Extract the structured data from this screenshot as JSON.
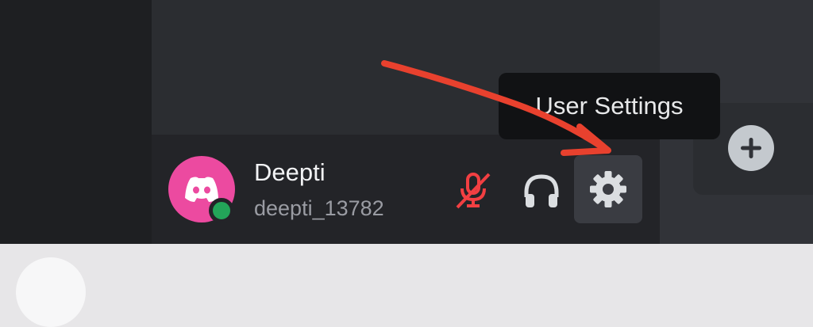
{
  "user": {
    "display_name": "Deepti",
    "username": "deepti_13782",
    "status": "online"
  },
  "controls": {
    "mic": {
      "icon": "mic-muted-icon",
      "muted": true
    },
    "headset": {
      "icon": "headset-icon"
    },
    "settings": {
      "icon": "gear-icon"
    }
  },
  "tooltip": {
    "text": "User Settings"
  },
  "add_button": {
    "icon": "plus-icon"
  },
  "annotation": {
    "icon": "red-arrow-annotation"
  },
  "colors": {
    "avatar_bg": "#ec4aa0",
    "status_online": "#23a559",
    "mute_red": "#f23f42",
    "annotation_red": "#e8412e"
  }
}
